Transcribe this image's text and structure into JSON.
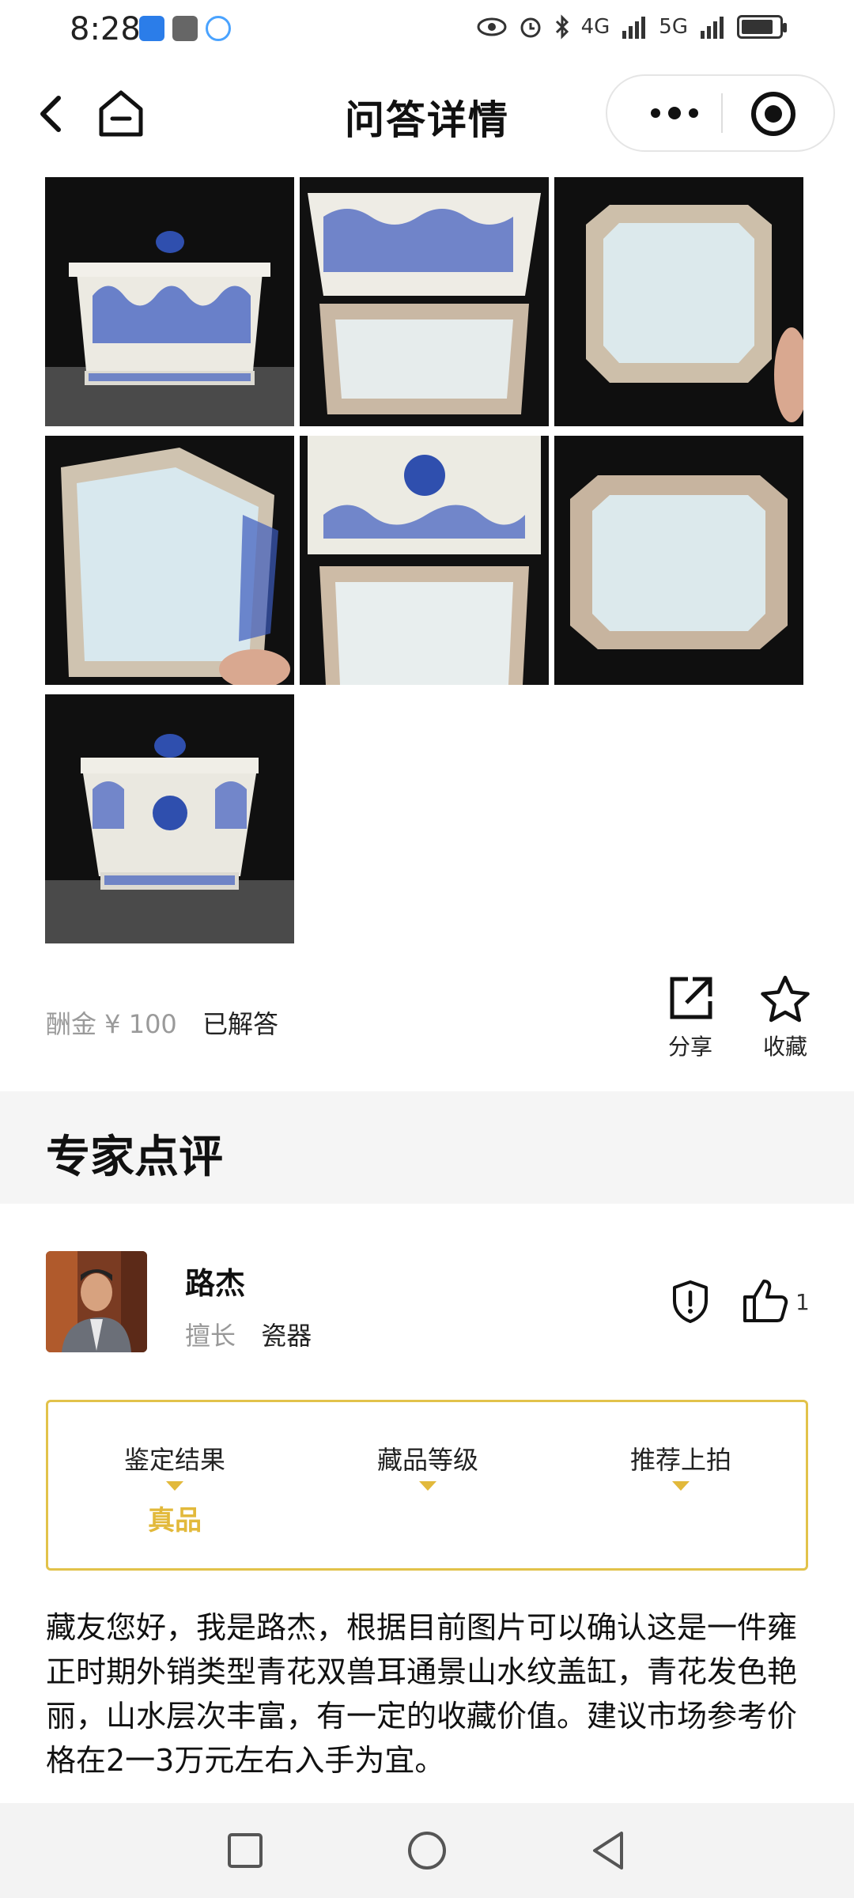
{
  "status_bar": {
    "time": "8:28",
    "network_1": "4G",
    "network_2": "5G",
    "battery_level": 0.85
  },
  "nav": {
    "title": "问答详情"
  },
  "question": {
    "reward": "酬金 ¥ 100",
    "status": "已解答",
    "share_label": "分享",
    "favorite_label": "收藏"
  },
  "section": {
    "title": "专家点评"
  },
  "expert": {
    "name": "路杰",
    "specialty_key": "擅长",
    "specialty_value": "瓷器",
    "like_count": "1"
  },
  "result": {
    "items": [
      {
        "label": "鉴定结果",
        "value": "真品"
      },
      {
        "label": "藏品等级",
        "value": ""
      },
      {
        "label": "推荐上拍",
        "value": ""
      }
    ]
  },
  "comment": {
    "text": "藏友您好，我是路杰，根据目前图片可以确认这是一件雍正时期外销类型青花双兽耳通景山水纹盖缸，青花发色艳丽，山水层次丰富，有一定的收藏价值。建议市场参考价格在2一3万元左右入手为宜。"
  },
  "colors": {
    "accent_gold": "#e2b93b",
    "box_border": "#e2c24a",
    "porcelain_blue": "#2f4fae"
  }
}
